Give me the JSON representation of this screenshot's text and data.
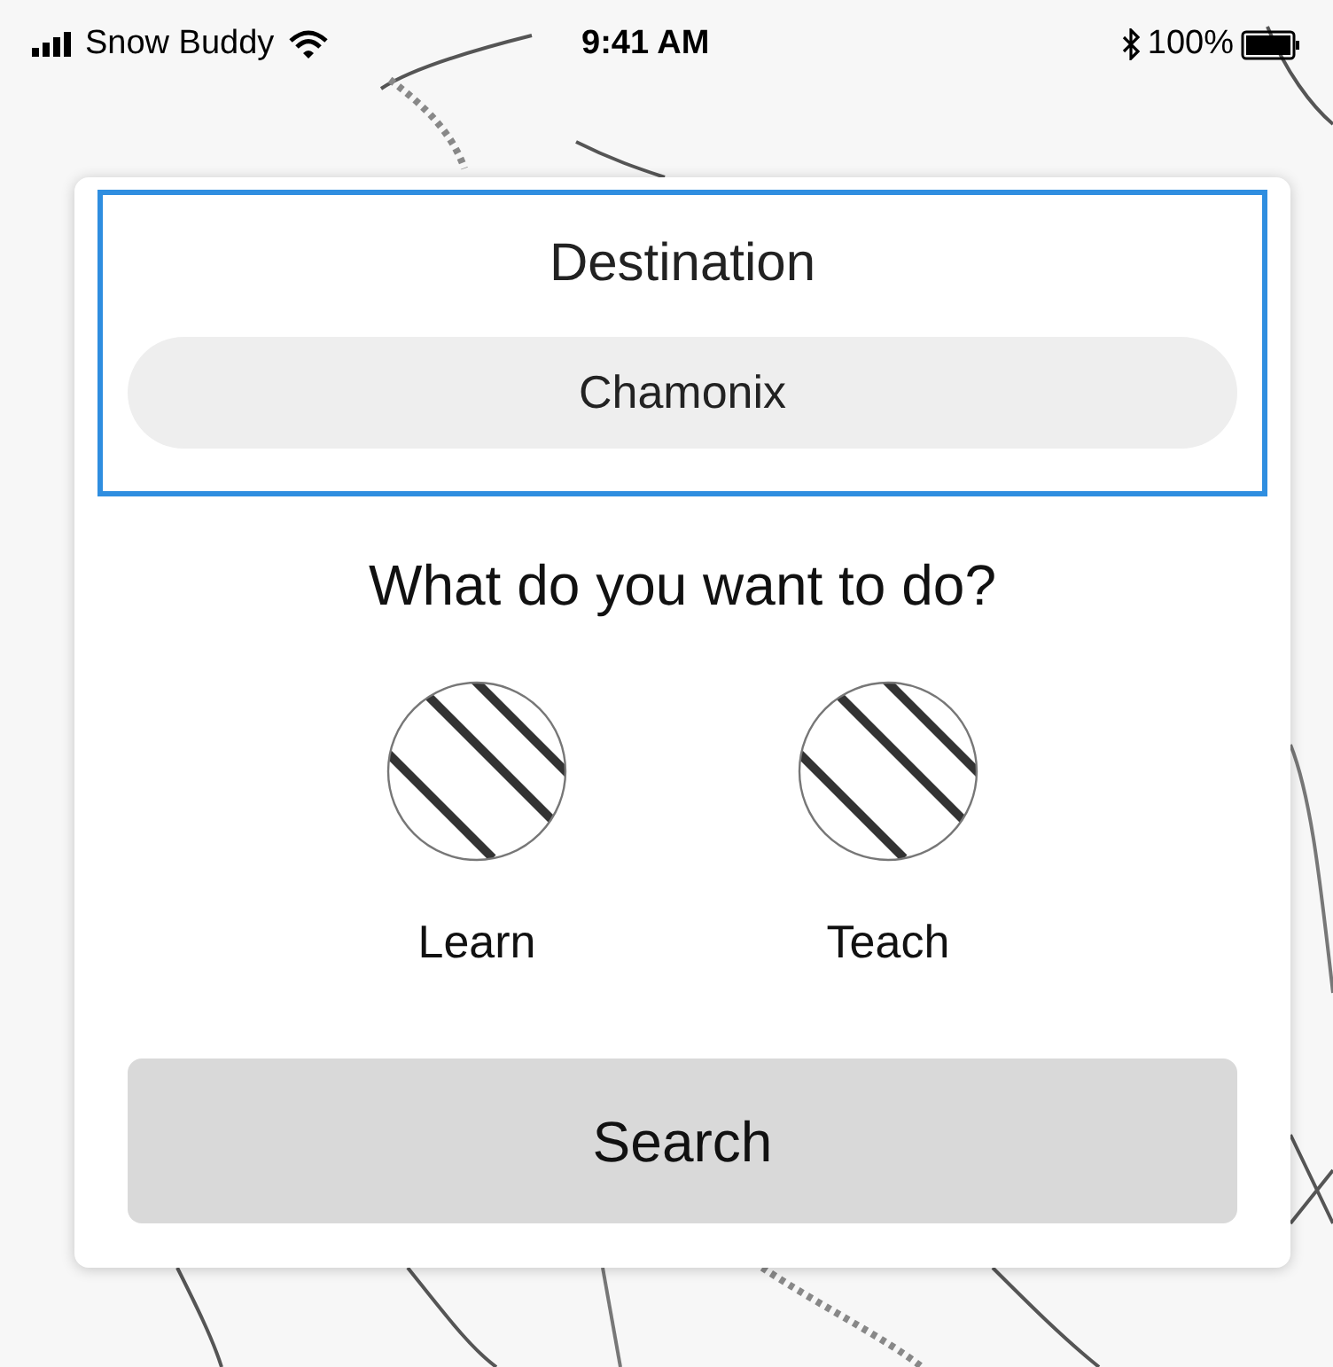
{
  "status_bar": {
    "carrier": "Snow Buddy",
    "time": "9:41 AM",
    "battery": "100%"
  },
  "destination": {
    "label": "Destination",
    "value": "Chamonix"
  },
  "question": "What do you want to do?",
  "options": [
    {
      "label": "Learn"
    },
    {
      "label": "Teach"
    }
  ],
  "search_button": "Search"
}
